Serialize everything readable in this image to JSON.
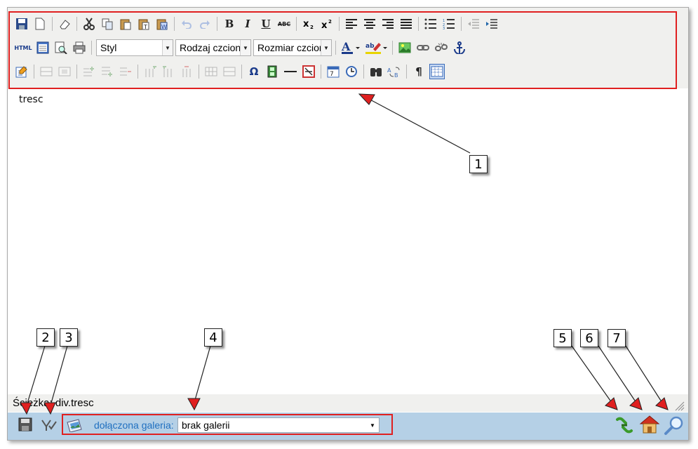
{
  "editor": {
    "content_text": "tresc",
    "path_label": "Ścieżka:",
    "path_value": "div.tresc",
    "toolbar": {
      "html_label": "HTML",
      "bold_label": "B",
      "italic_label": "I",
      "underline_label": "U",
      "strike_label": "ABC",
      "style_combo": "Styl",
      "font_combo": "Rodzaj czcionki",
      "size_combo": "Rozmiar czcionki",
      "omega_label": "Ω",
      "pilcrow_label": "¶"
    }
  },
  "status_bar": {
    "gallery_label": "dołączona galeria:",
    "gallery_value": "brak galerii"
  },
  "callouts": [
    "1",
    "2",
    "3",
    "4",
    "5",
    "6",
    "7"
  ],
  "colors": {
    "highlight_red": "#e02020",
    "status_bar_bg": "#b5d0e6",
    "toolbar_bg": "#f0f0ee",
    "label_blue": "#2070c0"
  }
}
